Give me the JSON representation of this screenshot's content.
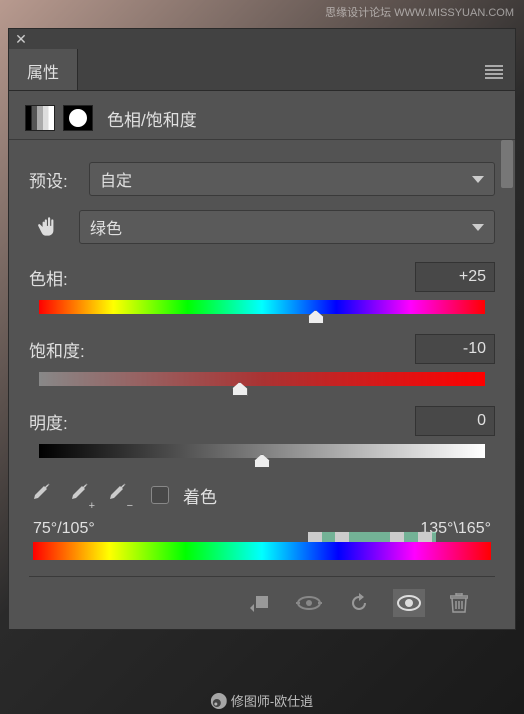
{
  "watermark": "思缘设计论坛  WWW.MISSYUAN.COM",
  "panel": {
    "title": "属性",
    "adjustment_name": "色相/饱和度"
  },
  "preset": {
    "label": "预设:",
    "value": "自定"
  },
  "channel": {
    "value": "绿色"
  },
  "sliders": {
    "hue": {
      "label": "色相:",
      "value": "+25",
      "pos": 62
    },
    "saturation": {
      "label": "饱和度:",
      "value": "-10",
      "pos": 45
    },
    "lightness": {
      "label": "明度:",
      "value": "0",
      "pos": 50
    }
  },
  "colorize": {
    "label": "着色"
  },
  "range": {
    "left": "75°/105°",
    "right": "135°\\165°"
  },
  "credit": "修图师-欧仕逍"
}
